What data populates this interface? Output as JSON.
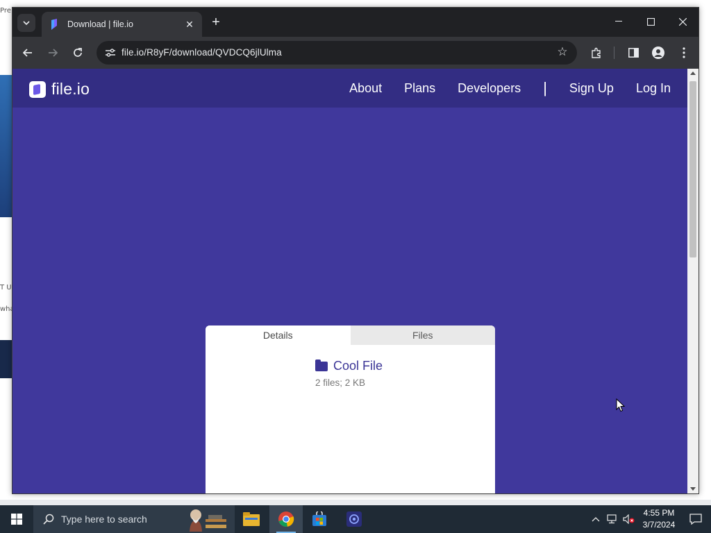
{
  "browser": {
    "tab": {
      "title": "Download | file.io"
    },
    "address_bar": {
      "url": "file.io/R8yF/download/QVDCQ6jlUlma"
    }
  },
  "site": {
    "logo_text": "file.io",
    "nav": {
      "about": "About",
      "plans": "Plans",
      "developers": "Developers",
      "divider": "|",
      "sign_up": "Sign Up",
      "log_in": "Log In"
    },
    "card": {
      "tabs": {
        "details": "Details",
        "files": "Files"
      },
      "file_name": "Cool File",
      "file_meta": "2 files; 2 KB"
    }
  },
  "taskbar": {
    "search_placeholder": "Type here to search",
    "time": "4:55 PM",
    "date": "3/7/2024"
  },
  "background_fragments": {
    "top_left": "Pre",
    "mid_left_1": "T US",
    "mid_left_2": "wha"
  },
  "colors": {
    "page_bg": "#40389c",
    "site_nav_bg": "#332d83",
    "accent": "#3b3596"
  }
}
